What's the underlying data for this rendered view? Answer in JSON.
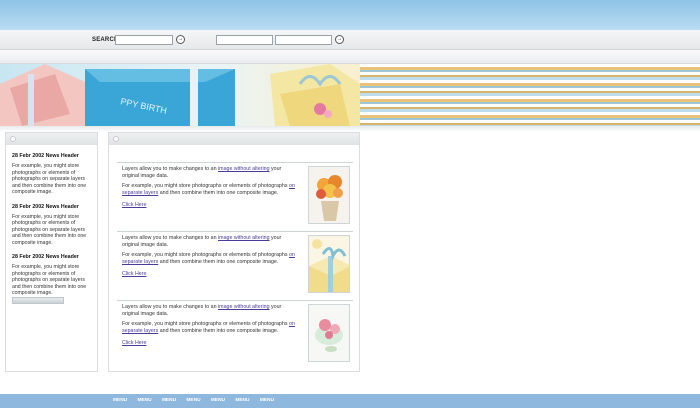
{
  "search": {
    "label": "SEARCH",
    "input1": "",
    "input2": "",
    "input3": ""
  },
  "news": [
    {
      "header": "28 Febr 2002 News Header",
      "body": "For example, you might store photographs or elements of photographs on separate layers and then combine them into one composite image."
    },
    {
      "header": "28 Febr 2002 News Header",
      "body": "For example, you might store photographs or elements of photographs on separate layers and then combine them into one composite image."
    },
    {
      "header": "28 Febr 2002 News Header",
      "body": "For example, you might store photographs or elements of photographs on separate layers and then combine them into one composite image."
    }
  ],
  "items": [
    {
      "p1_pre": "Layers allow you to make changes to an ",
      "p1_link": "image without altering",
      "p1_post": " your original image data.",
      "p2_pre": "For example, you might store photographs or elements of photographs ",
      "p2_link": "on separate layers",
      "p2_post": " and then combine them into one composite image.",
      "click": "Click Here"
    },
    {
      "p1_pre": "Layers allow you to make changes to an ",
      "p1_link": "image without altering",
      "p1_post": " your original image data.",
      "p2_pre": "For example, you might store photographs or elements of photographs ",
      "p2_link": "on separate layers",
      "p2_post": " and then combine them into one composite image.",
      "click": "Click Here"
    },
    {
      "p1_pre": "Layers allow you to make changes to an ",
      "p1_link": "image without altering",
      "p1_post": " your original image data.",
      "p2_pre": "For example, you might store photographs or elements of photographs ",
      "p2_link": "on separate layers",
      "p2_post": " and then combine them into one composite image.",
      "click": "Click Here"
    }
  ],
  "menu": [
    "MENU",
    "MENU",
    "MENU",
    "MENU",
    "MENU",
    "MENU",
    "MENU"
  ],
  "colors": {
    "sky": "#8fc3e6",
    "footer": "#8fb8df",
    "link": "#4a3a9a"
  }
}
